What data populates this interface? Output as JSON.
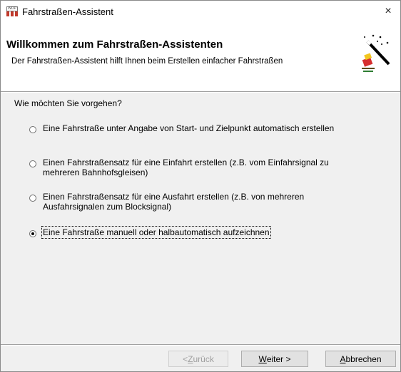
{
  "window": {
    "title": "Fahrstraßen-Assistent",
    "close_glyph": "×",
    "app_icon": "win-digipet-app-icon",
    "app_icon_text": "WDP"
  },
  "header": {
    "title": "Willkommen zum Fahrstraßen-Assistenten",
    "subtitle": "Der Fahrstraßen-Assistent hilft Ihnen beim Erstellen einfacher Fahrstraßen",
    "icon": "magic-wand-icon"
  },
  "question": "Wie möchten Sie vorgehen?",
  "options": [
    {
      "label": "Eine Fahrstraße unter Angabe von Start- und Zielpunkt automatisch erstellen",
      "selected": false
    },
    {
      "label": "Einen Fahrstraßensatz für eine Einfahrt erstellen (z.B. vom Einfahrsignal zu mehreren Bahnhofsgleisen)",
      "selected": false
    },
    {
      "label": "Einen Fahrstraßensatz für eine Ausfahrt erstellen (z.B. von mehreren Ausfahrsignalen zum Blocksignal)",
      "selected": false
    },
    {
      "label": "Eine Fahrstraße manuell oder halbautomatisch aufzeichnen",
      "selected": true
    }
  ],
  "buttons": {
    "back": {
      "prefix": "< ",
      "accel": "Z",
      "rest": "urück",
      "enabled": false
    },
    "next": {
      "accel": "W",
      "rest": "eiter >",
      "enabled": true
    },
    "cancel": {
      "accel": "A",
      "rest": "bbrechen",
      "enabled": true
    }
  },
  "colors": {
    "header_bg": "#ffffff",
    "dialog_bg": "#f0f0f0",
    "button_bg": "#e1e1e1",
    "disabled_text": "#a0a0a0"
  }
}
